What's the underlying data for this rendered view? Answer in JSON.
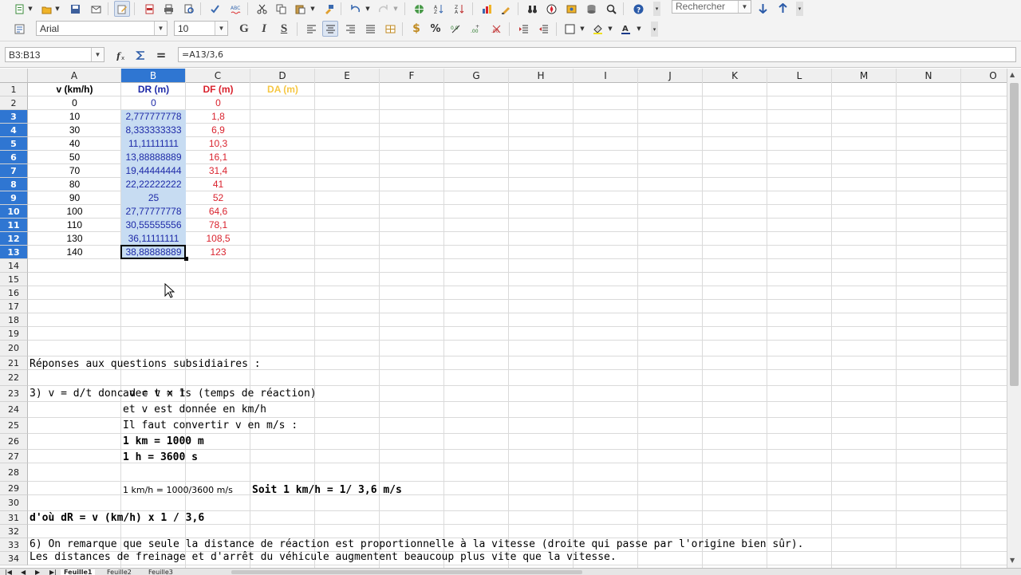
{
  "toolbar_top": {
    "search_placeholder": "Rechercher",
    "icons": [
      "new-document-icon",
      "open-folder-icon",
      "save-icon",
      "email-icon",
      "edit-mode-icon",
      "export-pdf-icon",
      "print-icon",
      "print-preview-icon",
      "spellcheck-icon",
      "autospell-icon",
      "cut-icon",
      "copy-icon",
      "paste-icon",
      "clone-formatting-icon",
      "undo-icon",
      "redo-icon",
      "hyperlink-icon",
      "sort-ascending-icon",
      "sort-descending-icon",
      "chart-icon",
      "draw-functions-icon",
      "navigator-icon",
      "gallery-icon",
      "datasources-icon",
      "zoom-icon",
      "help-icon"
    ]
  },
  "toolbar_format": {
    "font_name": "Arial",
    "font_size": "10",
    "bold_label": "G",
    "italic_label": "I",
    "underline_label": "S",
    "currency_label": "$",
    "percent_label": "%"
  },
  "formula_bar": {
    "name_box": "B3:B13",
    "formula": "=A13/3,6",
    "equals_label": "="
  },
  "columns": [
    "A",
    "B",
    "C",
    "D",
    "E",
    "F",
    "G",
    "H",
    "I",
    "J",
    "K",
    "L",
    "M",
    "N",
    "O"
  ],
  "rows": [
    "1",
    "2",
    "3",
    "4",
    "5",
    "6",
    "7",
    "8",
    "9",
    "10",
    "11",
    "12",
    "13",
    "14",
    "15",
    "16",
    "17",
    "18",
    "19",
    "20",
    "21",
    "22",
    "23",
    "24",
    "25",
    "26",
    "27",
    "28",
    "29",
    "30",
    "31",
    "32",
    "33",
    "34"
  ],
  "selected_column": "B",
  "selected_rows": [
    "3",
    "4",
    "5",
    "6",
    "7",
    "8",
    "9",
    "10",
    "11",
    "12",
    "13"
  ],
  "headers": {
    "A": "v (km/h)",
    "B": "DR (m)",
    "C": "DF (m)",
    "D": "DA (m)"
  },
  "colors": {
    "col_a": "#000000",
    "col_b": "#1e2aa8",
    "col_c": "#d9232e",
    "col_d": "#f6c744",
    "selection_fill": "#c7dcf2",
    "header_selected": "#2f76d2"
  },
  "table": [
    {
      "v": "0",
      "dr": "0",
      "df": "0"
    },
    {
      "v": "10",
      "dr": "2,777777778",
      "df": "1,8"
    },
    {
      "v": "30",
      "dr": "8,333333333",
      "df": "6,9"
    },
    {
      "v": "40",
      "dr": "11,11111111",
      "df": "10,3"
    },
    {
      "v": "50",
      "dr": "13,88888889",
      "df": "16,1"
    },
    {
      "v": "70",
      "dr": "19,44444444",
      "df": "31,4"
    },
    {
      "v": "80",
      "dr": "22,22222222",
      "df": "41"
    },
    {
      "v": "90",
      "dr": "25",
      "df": "52"
    },
    {
      "v": "100",
      "dr": "27,77777778",
      "df": "64,6"
    },
    {
      "v": "110",
      "dr": "30,55555556",
      "df": "78,1"
    },
    {
      "v": "130",
      "dr": "36,11111111",
      "df": "108,5"
    },
    {
      "v": "140",
      "dr": "38,88888889",
      "df": "123"
    }
  ],
  "notes": {
    "r21": "Réponses aux questions subsidiaires :",
    "r23a": "3) v = d/t donc d = v x t",
    "r23b": "avec t = 1s  (temps de réaction)",
    "r24": "et v est donnée en km/h",
    "r25": "Il faut convertir v en m/s :",
    "r26": "1 km = 1000 m",
    "r27": "1 h = 3600 s",
    "r29a": "1 km/h = 1000/3600 m/s",
    "r29b": "Soit 1 km/h = 1/ 3,6 m/s",
    "r31": "d'où dR = v (km/h) x 1 / 3,6",
    "r33": "6) On remarque que seule la distance de réaction est proportionnelle à la vitesse (droite qui passe par l'origine bien sûr).",
    "r34": "Les distances de freinage et d'arrêt du véhicule augmentent beaucoup plus vite que la vitesse."
  },
  "sheet_tabs": [
    "Feuille1",
    "Feuille2",
    "Feuille3"
  ]
}
